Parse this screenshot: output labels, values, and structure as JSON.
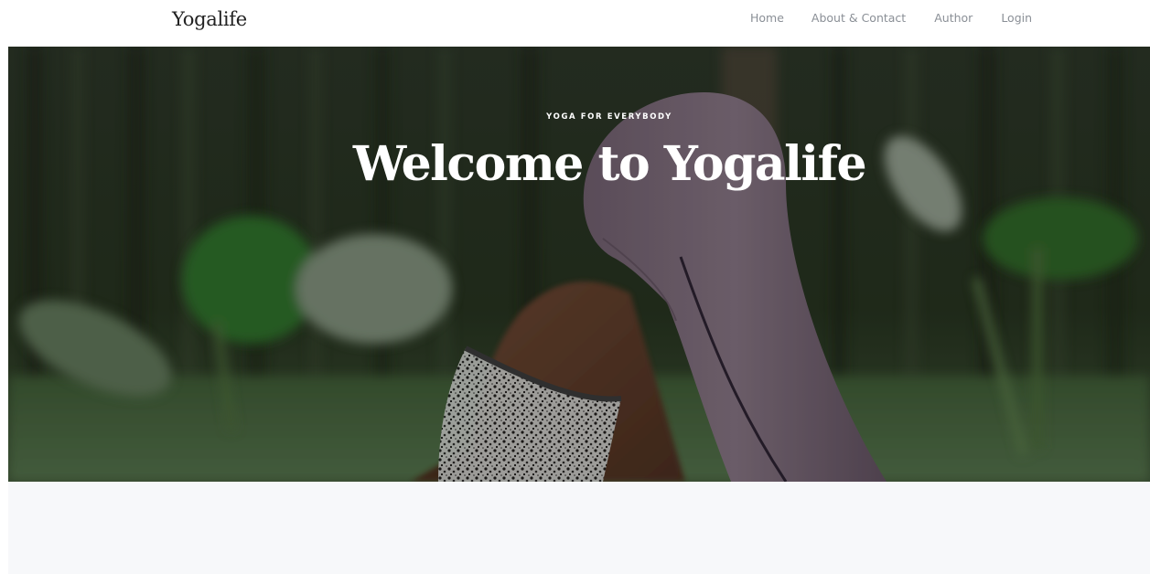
{
  "brand": "Yogalife",
  "nav": {
    "home": "Home",
    "about": "About & Contact",
    "author": "Author",
    "login": "Login"
  },
  "hero": {
    "eyebrow": "YOGA FOR EVERYBODY",
    "title": "Welcome to Yogalife"
  },
  "colors": {
    "nav_text": "#8a8f96",
    "brand_text": "#222222",
    "section_bg": "#f7f8fa",
    "leggings": "#6b5a6a"
  }
}
